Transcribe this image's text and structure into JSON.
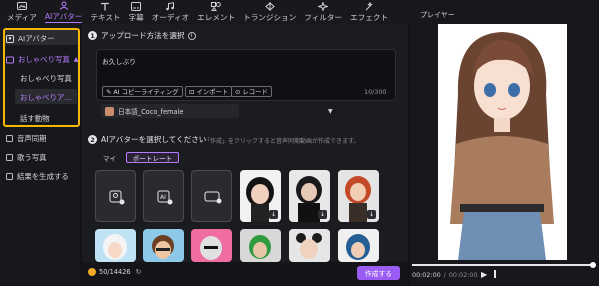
{
  "nav": {
    "tabs": [
      {
        "label": "メディア",
        "icon": "media-icon"
      },
      {
        "label": "AIアバター",
        "icon": "avatar-icon",
        "active": true
      },
      {
        "label": "テキスト",
        "icon": "text-icon"
      },
      {
        "label": "字幕",
        "icon": "subtitle-icon"
      },
      {
        "label": "オーディオ",
        "icon": "audio-icon"
      },
      {
        "label": "エレメント",
        "icon": "element-icon"
      },
      {
        "label": "トランジション",
        "icon": "transition-icon"
      },
      {
        "label": "フィルター",
        "icon": "filter-icon"
      },
      {
        "label": "エフェクト",
        "icon": "effect-icon"
      }
    ]
  },
  "sidebar": {
    "header": "AIアバター",
    "group": "おしゃべり写真",
    "sub": [
      "おしゃべり写真",
      "おしゃべりア...",
      "話す動物"
    ],
    "items": [
      "音声同期",
      "歌う写真",
      "結果を生成する"
    ]
  },
  "section1": {
    "title": "アップロード方法を選択",
    "text_value": "お久しぶり",
    "counter": "10/300",
    "chips": [
      "AI コピーライティング",
      "インポート",
      "レコード"
    ],
    "voice": "日本語_Coco_female"
  },
  "section2": {
    "title": "AIアバターを選択してください",
    "hint": "「作成」をクリックすると音声同期動画が作成できます。",
    "tabs": [
      "マイ",
      "ポートレート"
    ]
  },
  "footer": {
    "credits": "50/14426",
    "create_label": "作成する"
  },
  "player": {
    "title": "プレイヤー",
    "current_time": "00:02:00",
    "total_time": "00:02:00"
  },
  "colors": {
    "accent": "#9b5cf6",
    "highlight": "#f5b800"
  }
}
